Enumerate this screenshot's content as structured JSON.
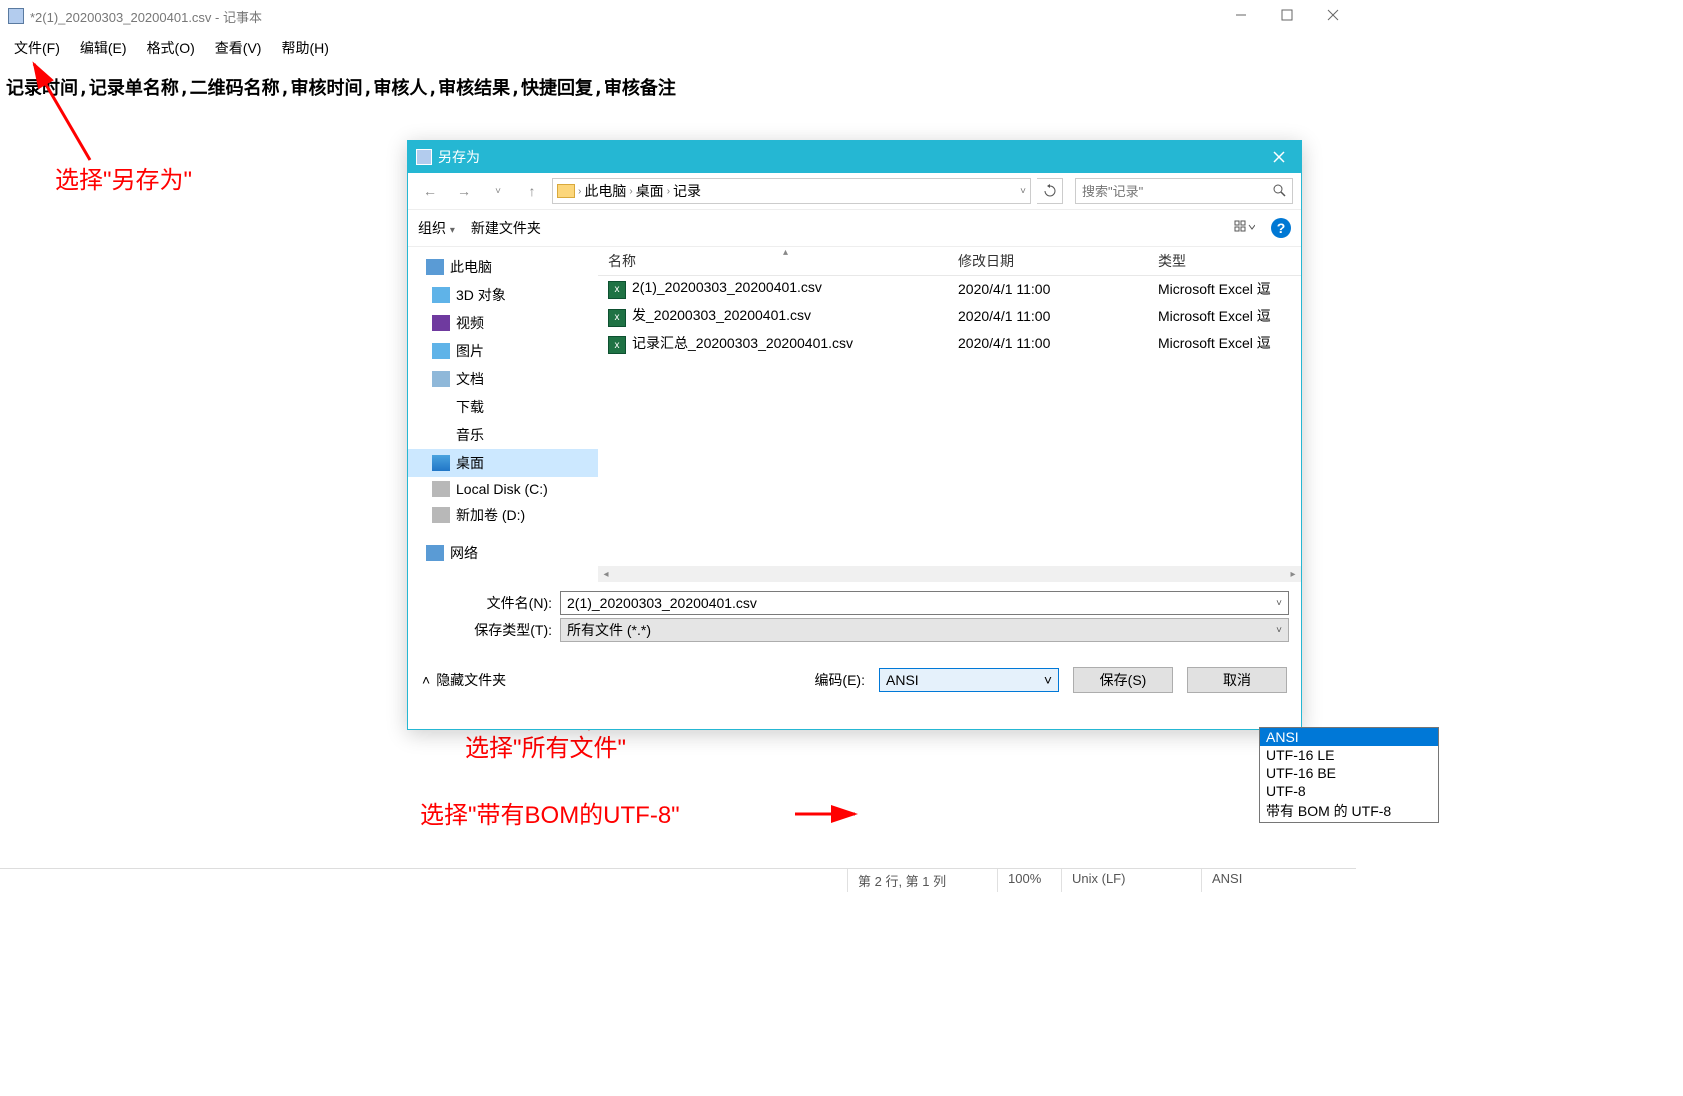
{
  "notepad": {
    "title": "*2(1)_20200303_20200401.csv - 记事本",
    "menu": [
      "文件(F)",
      "编辑(E)",
      "格式(O)",
      "查看(V)",
      "帮助(H)"
    ],
    "content": "记录时间,记录单名称,二维码名称,审核时间,审核人,审核结果,快捷回复,审核备注"
  },
  "annotations": {
    "a1": "选择\"另存为\"",
    "a2": "选择\"所有文件\"",
    "a3": "选择\"带有BOM的UTF-8\""
  },
  "dialog": {
    "title": "另存为",
    "breadcrumb": [
      "此电脑",
      "桌面",
      "记录"
    ],
    "search_placeholder": "搜索\"记录\"",
    "toolbar": {
      "organize": "组织",
      "newfolder": "新建文件夹"
    },
    "tree": [
      {
        "label": "此电脑",
        "icon": "ico-pc",
        "cls": "bold"
      },
      {
        "label": "3D 对象",
        "icon": "ico-3d"
      },
      {
        "label": "视频",
        "icon": "ico-video"
      },
      {
        "label": "图片",
        "icon": "ico-pic"
      },
      {
        "label": "文档",
        "icon": "ico-doc"
      },
      {
        "label": "下载",
        "icon": "ico-dl"
      },
      {
        "label": "音乐",
        "icon": "ico-music"
      },
      {
        "label": "桌面",
        "icon": "ico-desktop",
        "sel": true
      },
      {
        "label": "Local Disk (C:)",
        "icon": "ico-disk"
      },
      {
        "label": "新加卷 (D:)",
        "icon": "ico-disk"
      },
      {
        "label": "网络",
        "icon": "ico-net",
        "cls": "bold",
        "style": "margin-top:10px"
      }
    ],
    "columns": {
      "name": "名称",
      "date": "修改日期",
      "type": "类型"
    },
    "files": [
      {
        "name": "2(1)_20200303_20200401.csv",
        "date": "2020/4/1 11:00",
        "type": "Microsoft Excel 逗"
      },
      {
        "name": "发_20200303_20200401.csv",
        "date": "2020/4/1 11:00",
        "type": "Microsoft Excel 逗"
      },
      {
        "name": "记录汇总_20200303_20200401.csv",
        "date": "2020/4/1 11:00",
        "type": "Microsoft Excel 逗"
      }
    ],
    "filename_label": "文件名(N):",
    "filename_value": "2(1)_20200303_20200401.csv",
    "savetype_label": "保存类型(T):",
    "savetype_value": "所有文件  (*.*)",
    "hide_folders": "隐藏文件夹",
    "encoding_label": "编码(E):",
    "encoding_value": "ANSI",
    "encoding_options": [
      "ANSI",
      "UTF-16 LE",
      "UTF-16 BE",
      "UTF-8",
      "带有 BOM 的 UTF-8"
    ],
    "save_btn": "保存(S)",
    "cancel_btn": "取消"
  },
  "statusbar": {
    "position": "第 2 行,  第 1 列",
    "zoom": "100%",
    "lineend": "Unix (LF)",
    "encoding": "ANSI"
  }
}
